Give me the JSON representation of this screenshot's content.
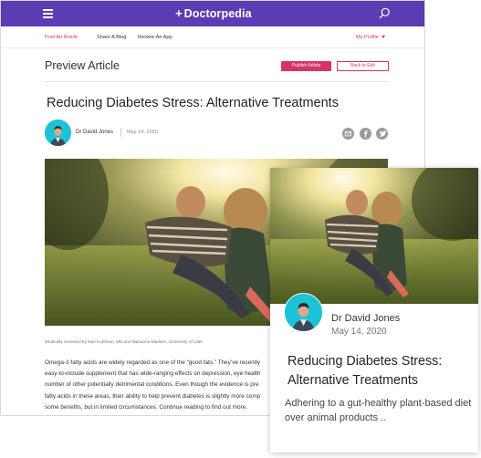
{
  "app": {
    "logo_mark": "+",
    "logo_text": "Doctorpedia",
    "brand_color": "#5b3db3",
    "accent_color": "#d6336c",
    "avatar_color": "#1cc3d6"
  },
  "nav": {
    "items": [
      "Post An Article",
      "Share A Blog",
      "Review An App"
    ],
    "active_index": 0,
    "profile_label": "My Profile"
  },
  "preview": {
    "heading": "Preview Article",
    "publish_label": "Publish Article",
    "back_label": "Back to Edit"
  },
  "article": {
    "title": "Reducing Diabetes Stress:  Alternative Treatments",
    "author": "Dr David Jones",
    "date": "May 14, 2020",
    "share_icons": [
      "email-icon",
      "facebook-icon",
      "twitter-icon"
    ],
    "caption": "Medically reviewed by Nan Kuhlman, MD and Marianne Madsen, University of Utah",
    "body_lines": [
      "Omega-3 fatty acids are widely regarded as one of the “good fats.” They’ve recently",
      "easy-to-include supplement that has wide-ranging effects on depression, eye health",
      "number of other potentially detrimental conditions. Even though the evidence is pre",
      "fatty acids in these areas, their ability to help prevent diabetes is slightly more comp",
      "some benefits, but in limited circumstances. Continue reading to find out more."
    ]
  },
  "card": {
    "author": "Dr David Jones",
    "date": "May 14, 2020",
    "title": "Reducing Diabetes Stress: Alternative Treatments",
    "excerpt": "Adhering to a gut-healthy plant-based diet over animal products .."
  }
}
